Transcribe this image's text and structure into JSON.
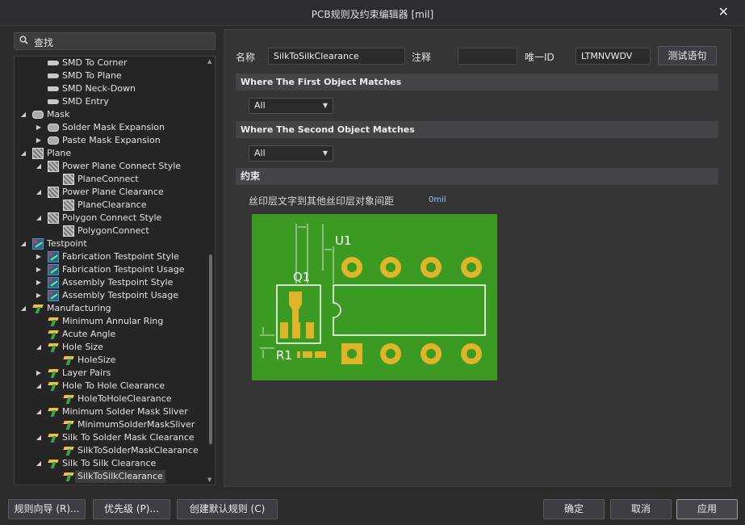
{
  "window": {
    "title": "PCB规则及约束编辑器 [mil]"
  },
  "search": {
    "label": "查找"
  },
  "tree": [
    {
      "label": "SMD To Corner",
      "level": 3,
      "icon": "smd-icon",
      "expander": ""
    },
    {
      "label": "SMD To Plane",
      "level": 3,
      "icon": "smd-icon",
      "expander": ""
    },
    {
      "label": "SMD Neck-Down",
      "level": 3,
      "icon": "smd-icon",
      "expander": ""
    },
    {
      "label": "SMD Entry",
      "level": 3,
      "icon": "smd-icon",
      "expander": ""
    },
    {
      "label": "Mask",
      "level": 2,
      "icon": "mask-icon",
      "expander": "expanded"
    },
    {
      "label": "Solder Mask Expansion",
      "level": 3,
      "icon": "mask-icon",
      "expander": "collapsed"
    },
    {
      "label": "Paste Mask Expansion",
      "level": 3,
      "icon": "mask-icon",
      "expander": "collapsed"
    },
    {
      "label": "Plane",
      "level": 2,
      "icon": "plane-icon",
      "expander": "expanded"
    },
    {
      "label": "Power Plane Connect Style",
      "level": 3,
      "icon": "plane-icon",
      "expander": "expanded"
    },
    {
      "label": "PlaneConnect",
      "level": 4,
      "icon": "plane-icon",
      "expander": ""
    },
    {
      "label": "Power Plane Clearance",
      "level": 3,
      "icon": "plane-icon",
      "expander": "expanded"
    },
    {
      "label": "PlaneClearance",
      "level": 4,
      "icon": "plane-icon",
      "expander": ""
    },
    {
      "label": "Polygon Connect Style",
      "level": 3,
      "icon": "plane-icon",
      "expander": "expanded"
    },
    {
      "label": "PolygonConnect",
      "level": 4,
      "icon": "plane-icon",
      "expander": ""
    },
    {
      "label": "Testpoint",
      "level": 2,
      "icon": "testpoint-icon",
      "expander": "expanded"
    },
    {
      "label": "Fabrication Testpoint Style",
      "level": 3,
      "icon": "testpoint-icon",
      "expander": "collapsed"
    },
    {
      "label": "Fabrication Testpoint Usage",
      "level": 3,
      "icon": "testpoint-icon",
      "expander": "collapsed"
    },
    {
      "label": "Assembly Testpoint Style",
      "level": 3,
      "icon": "testpoint-icon",
      "expander": "collapsed"
    },
    {
      "label": "Assembly Testpoint Usage",
      "level": 3,
      "icon": "testpoint-icon",
      "expander": "collapsed"
    },
    {
      "label": "Manufacturing",
      "level": 2,
      "icon": "manufacturing-icon",
      "expander": "expanded"
    },
    {
      "label": "Minimum Annular Ring",
      "level": 3,
      "icon": "manufacturing-icon",
      "expander": ""
    },
    {
      "label": "Acute Angle",
      "level": 3,
      "icon": "manufacturing-icon",
      "expander": ""
    },
    {
      "label": "Hole Size",
      "level": 3,
      "icon": "manufacturing-icon",
      "expander": "expanded"
    },
    {
      "label": "HoleSize",
      "level": 4,
      "icon": "manufacturing-icon",
      "expander": ""
    },
    {
      "label": "Layer Pairs",
      "level": 3,
      "icon": "manufacturing-icon",
      "expander": "collapsed"
    },
    {
      "label": "Hole To Hole Clearance",
      "level": 3,
      "icon": "manufacturing-icon",
      "expander": "expanded"
    },
    {
      "label": "HoleToHoleClearance",
      "level": 4,
      "icon": "manufacturing-icon",
      "expander": ""
    },
    {
      "label": "Minimum Solder Mask Sliver",
      "level": 3,
      "icon": "manufacturing-icon",
      "expander": "expanded"
    },
    {
      "label": "MinimumSolderMaskSliver",
      "level": 4,
      "icon": "manufacturing-icon",
      "expander": ""
    },
    {
      "label": "Silk To Solder Mask Clearance",
      "level": 3,
      "icon": "manufacturing-icon",
      "expander": "expanded"
    },
    {
      "label": "SilkToSolderMaskClearance",
      "level": 4,
      "icon": "manufacturing-icon",
      "expander": ""
    },
    {
      "label": "Silk To Silk Clearance",
      "level": 3,
      "icon": "manufacturing-icon",
      "expander": "expanded"
    },
    {
      "label": "SilkToSilkClearance",
      "level": 4,
      "icon": "manufacturing-icon",
      "expander": "",
      "selected": true
    }
  ],
  "rule": {
    "name_label": "名称",
    "name_value": "SilkToSilkClearance",
    "comment_label": "注释",
    "comment_value": "",
    "uid_label": "唯一ID",
    "uid_value": "LTMNVWDV",
    "test_button": "测试语句"
  },
  "first_match": {
    "header": "Where The First Object Matches",
    "selected": "All"
  },
  "second_match": {
    "header": "Where The Second Object Matches",
    "selected": "All"
  },
  "constraints": {
    "header": "约束",
    "label": "丝印层文字到其他丝印层对象间距",
    "value": "0mil",
    "diagram": {
      "u1": "U1",
      "q1": "Q1",
      "r1": "R1"
    }
  },
  "footer": {
    "wizard": "规则向导 (R)...",
    "priority": "优先级 (P)...",
    "create_default": "创建默认规则 (C)",
    "ok": "确定",
    "cancel": "取消",
    "apply": "应用"
  },
  "colors": {
    "board": "#3b9a21",
    "pad": "#e0b52a",
    "silk": "#ffffff"
  }
}
